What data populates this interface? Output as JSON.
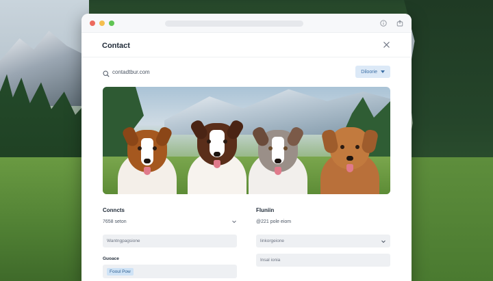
{
  "window": {
    "title": "Contact"
  },
  "toolbar": {
    "search_value": "contadtbur.com",
    "dropdown_label": "Diloorie"
  },
  "form": {
    "left": {
      "label": "Conncts",
      "sub_value": "7658 seton",
      "field_placeholder": "Wantngpagsione",
      "section_label": "Guoace",
      "chip_value": "Fooul Pow"
    },
    "right": {
      "label": "Fluniin",
      "sub_value": "@221 pole eiom",
      "select_placeholder": "linkorgeione",
      "field_placeholder": "Insal ionia"
    }
  },
  "colors": {
    "accent": "#3b6ea5",
    "accent_bg": "#dce9f7",
    "window_bg": "#ffffff",
    "field_bg": "#eef0f3"
  },
  "icons": [
    "search-icon",
    "info-icon",
    "share-icon",
    "close-icon",
    "chevron-down-icon"
  ]
}
